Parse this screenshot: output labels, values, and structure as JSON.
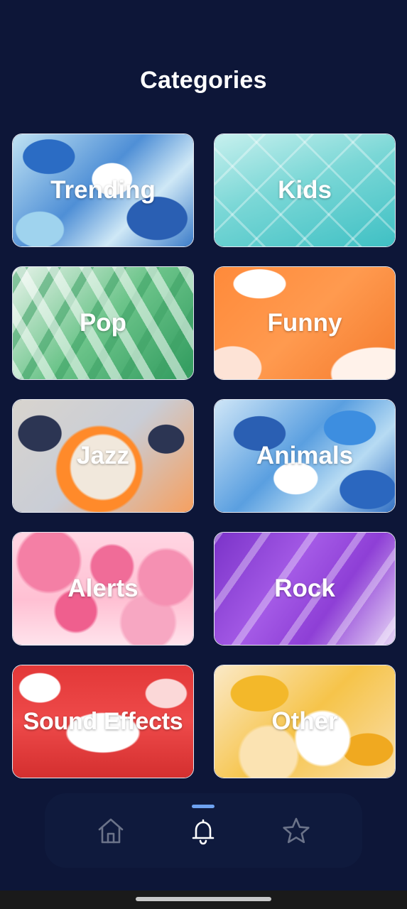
{
  "header": {
    "title": "Categories"
  },
  "categories": [
    {
      "label": "Trending"
    },
    {
      "label": "Kids"
    },
    {
      "label": "Pop"
    },
    {
      "label": "Funny"
    },
    {
      "label": "Jazz"
    },
    {
      "label": "Animals"
    },
    {
      "label": "Alerts"
    },
    {
      "label": "Rock"
    },
    {
      "label": "Sound Effects"
    },
    {
      "label": "Other"
    }
  ],
  "bottom_nav": {
    "items": [
      {
        "icon": "home-icon",
        "active": false
      },
      {
        "icon": "bell-icon",
        "active": true
      },
      {
        "icon": "star-icon",
        "active": false
      }
    ],
    "active_color": "#6ea2f0"
  },
  "colors": {
    "background": "#0d1638",
    "nav_background": "#0f1a3d",
    "icon_inactive": "#6b7389",
    "icon_active": "#ffffff"
  }
}
